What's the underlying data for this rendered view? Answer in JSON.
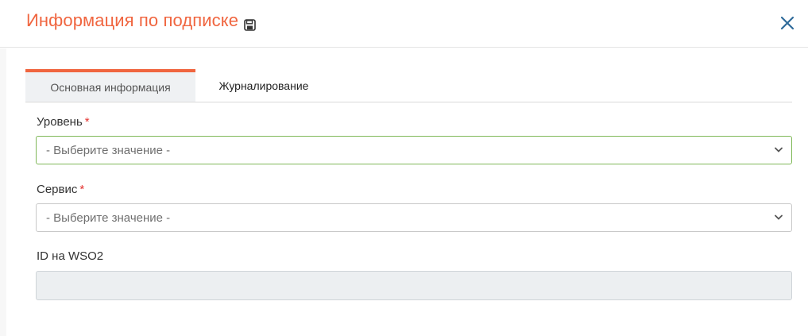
{
  "dialog": {
    "title": "Информация по подписке",
    "save_icon": "save-icon",
    "close_icon": "close-icon"
  },
  "tabs": [
    {
      "label": "Основная информация",
      "active": true
    },
    {
      "label": "Журналирование",
      "active": false
    }
  ],
  "form": {
    "level": {
      "label": "Уровень",
      "required_mark": "*",
      "placeholder": "- Выберите значение -"
    },
    "service": {
      "label": "Сервис",
      "required_mark": "*",
      "placeholder": "- Выберите значение -"
    },
    "wso2_id": {
      "label": "ID на WSO2",
      "value": ""
    }
  },
  "colors": {
    "accent": "#f0653f",
    "close": "#2f6b9a",
    "focus_border": "#7fb858",
    "required": "#e4322f"
  }
}
